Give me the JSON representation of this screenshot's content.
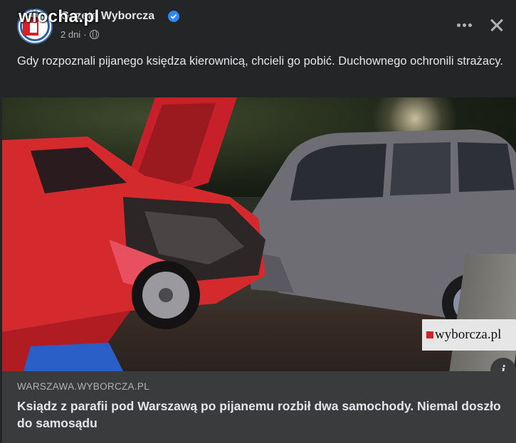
{
  "header": {
    "page_name": "Gazeta Wyborcza",
    "watermark": "wiocha.pl",
    "time": "2 dni",
    "time_separator": "·"
  },
  "post": {
    "caption": "Gdy rozpoznali pijanego księdza kierownicą, chcieli go pobić. Duchownego ochronili strażacy."
  },
  "photo": {
    "badge_text": "wyborcza.pl",
    "info_icon": "i"
  },
  "link": {
    "domain": "WARSZAWA.WYBORCZA.PL",
    "title": "Ksiądz z parafii pod Warszawą po pijanemu rozbił dwa samochody. Niemal doszło do samosądu"
  },
  "icons": {
    "verified": "verified-badge-icon",
    "privacy": "globe-icon",
    "more": "more-options-icon",
    "close": "close-icon",
    "info": "info-icon"
  },
  "colors": {
    "background": "#242526",
    "link_background": "#3a3b3c",
    "text_primary": "#e4e6eb",
    "text_secondary": "#b0b3b8",
    "verified_blue": "#2d88ff",
    "brand_red": "#d8202a"
  }
}
